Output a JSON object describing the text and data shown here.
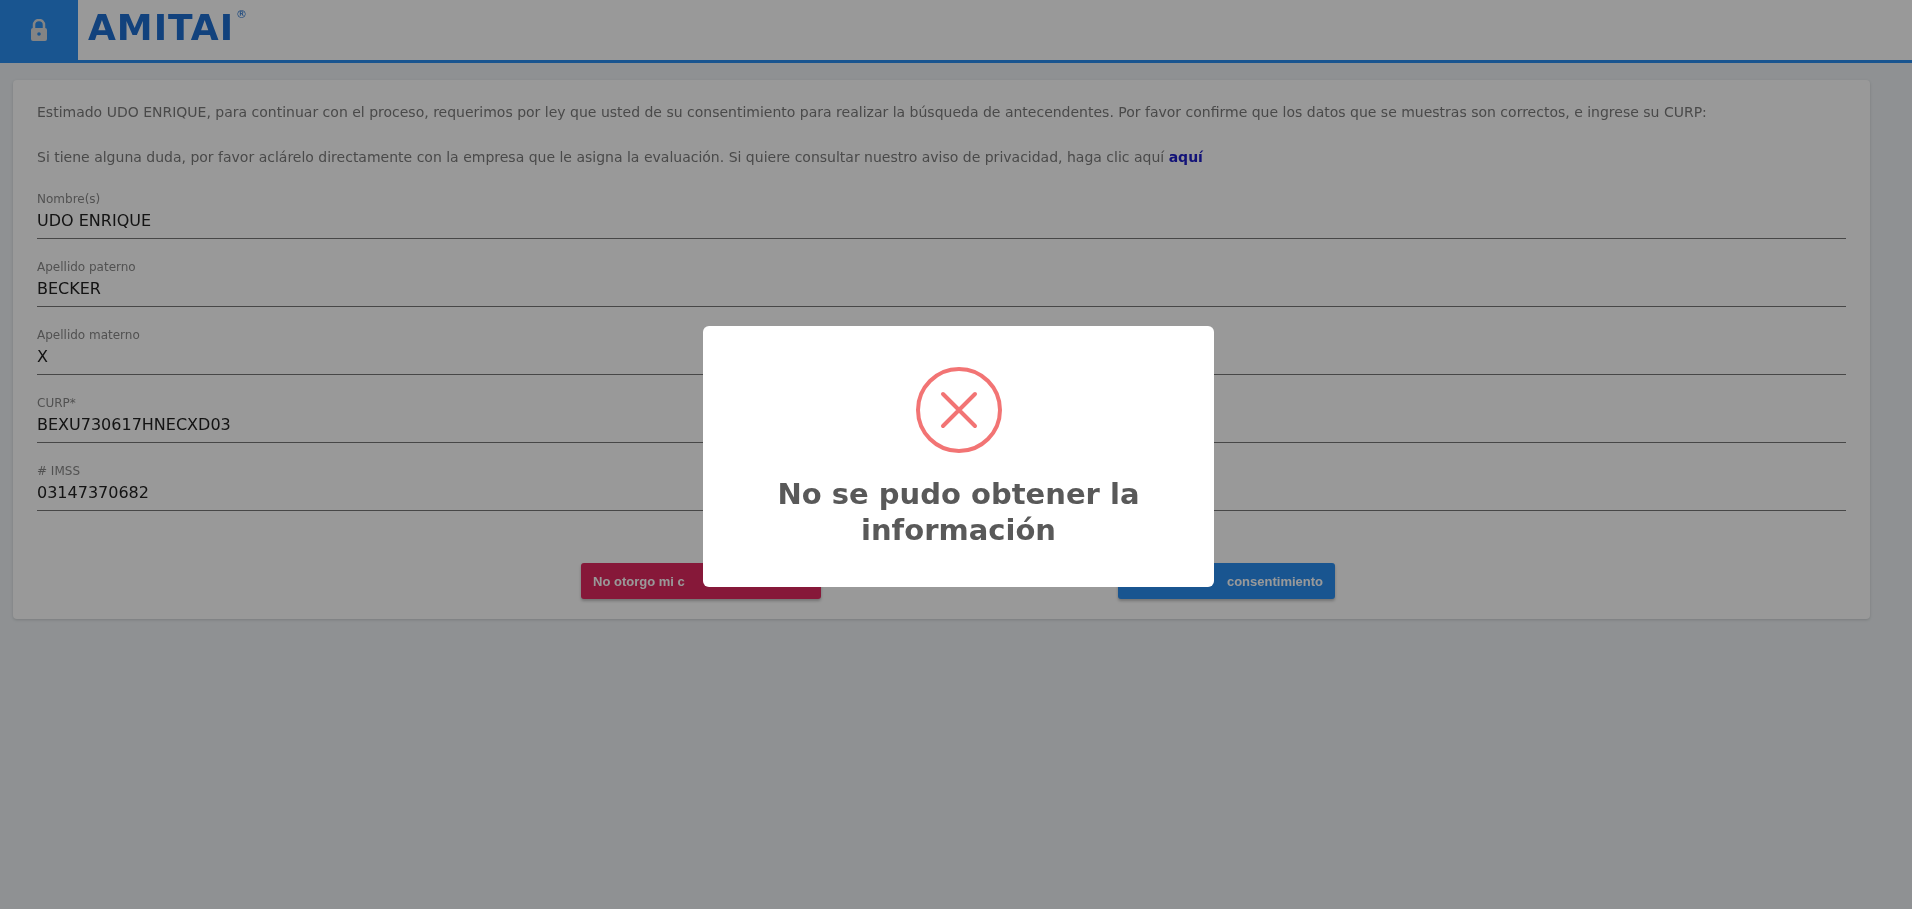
{
  "header": {
    "logo": "AMITAI",
    "registered_mark": "®"
  },
  "notice": {
    "intro": "Estimado UDO ENRIQUE, para continuar con el proceso, requerimos por ley que usted de su consentimiento para realizar la búsqueda de antecendentes. Por favor confirme que los datos que se muestras son correctos, e ingrese su CURP:",
    "privacy": "Si tiene alguna duda, por favor aclárelo directamente con la empresa que le asigna la evaluación. Si quiere consultar nuestro aviso de privacidad, haga clic aquí",
    "privacy_link": "aquí"
  },
  "fields": [
    {
      "label": "Nombre(s)",
      "value": "UDO ENRIQUE"
    },
    {
      "label": "Apellido paterno",
      "value": "BECKER"
    },
    {
      "label": "Apellido materno",
      "value": "X"
    },
    {
      "label": "CURP*",
      "value": "BEXU730617HNECXD03"
    },
    {
      "label": "# IMSS",
      "value": "03147370682"
    }
  ],
  "buttons": [
    {
      "label": "No otorgo mi c",
      "kind": "decline"
    },
    {
      "label": "consentimiento",
      "kind": "accept"
    }
  ],
  "dialog": {
    "kind": "error",
    "title": "No se pudo obtener la información"
  }
}
